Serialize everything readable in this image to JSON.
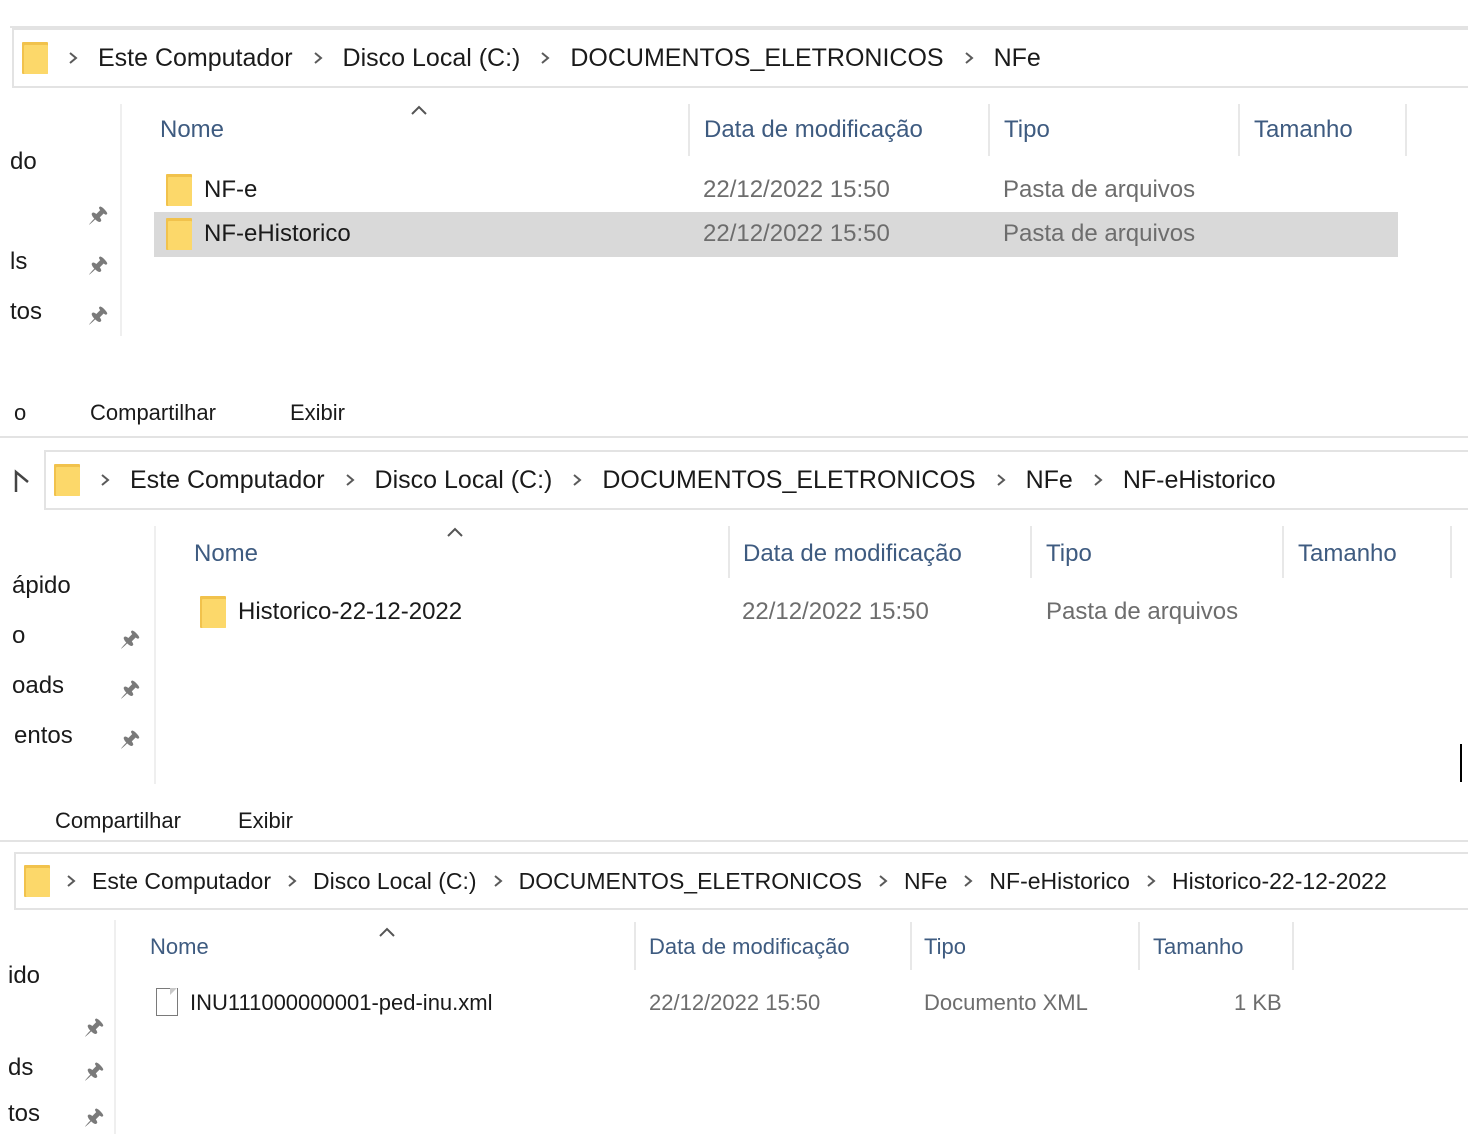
{
  "panel1": {
    "breadcrumb": [
      "Este Computador",
      "Disco Local (C:)",
      "DOCUMENTOS_ELETRONICOS",
      "NFe"
    ],
    "columns": {
      "name": "Nome",
      "date": "Data de modificação",
      "type": "Tipo",
      "size": "Tamanho"
    },
    "nav": [
      "do",
      "ls",
      "tos"
    ],
    "rows": [
      {
        "name": "NF-e",
        "date": "22/12/2022 15:50",
        "type": "Pasta de arquivos",
        "size": ""
      },
      {
        "name": "NF-eHistorico",
        "date": "22/12/2022 15:50",
        "type": "Pasta de arquivos",
        "size": ""
      }
    ]
  },
  "panel2": {
    "tabs": [
      "o",
      "Compartilhar",
      "Exibir"
    ],
    "breadcrumb": [
      "Este Computador",
      "Disco Local (C:)",
      "DOCUMENTOS_ELETRONICOS",
      "NFe",
      "NF-eHistorico"
    ],
    "columns": {
      "name": "Nome",
      "date": "Data de modificação",
      "type": "Tipo",
      "size": "Tamanho"
    },
    "nav": [
      "ápido",
      "o",
      "oads",
      "entos"
    ],
    "rows": [
      {
        "name": "Historico-22-12-2022",
        "date": "22/12/2022 15:50",
        "type": "Pasta de arquivos",
        "size": ""
      }
    ]
  },
  "panel3": {
    "tabs": [
      "Compartilhar",
      "Exibir"
    ],
    "breadcrumb": [
      "Este Computador",
      "Disco Local (C:)",
      "DOCUMENTOS_ELETRONICOS",
      "NFe",
      "NF-eHistorico",
      "Historico-22-12-2022"
    ],
    "columns": {
      "name": "Nome",
      "date": "Data de modificação",
      "type": "Tipo",
      "size": "Tamanho"
    },
    "nav": [
      "ido",
      "ds",
      "tos"
    ],
    "rows": [
      {
        "name": "INU111000000001-ped-inu.xml",
        "date": "22/12/2022 15:50",
        "type": "Documento XML",
        "size": "1 KB"
      }
    ]
  },
  "icons": {
    "folder": "folder-icon",
    "file": "xml-file-icon",
    "pin": "pin-icon",
    "chevron": "chevron-right-icon",
    "sort": "sort-up-icon"
  }
}
